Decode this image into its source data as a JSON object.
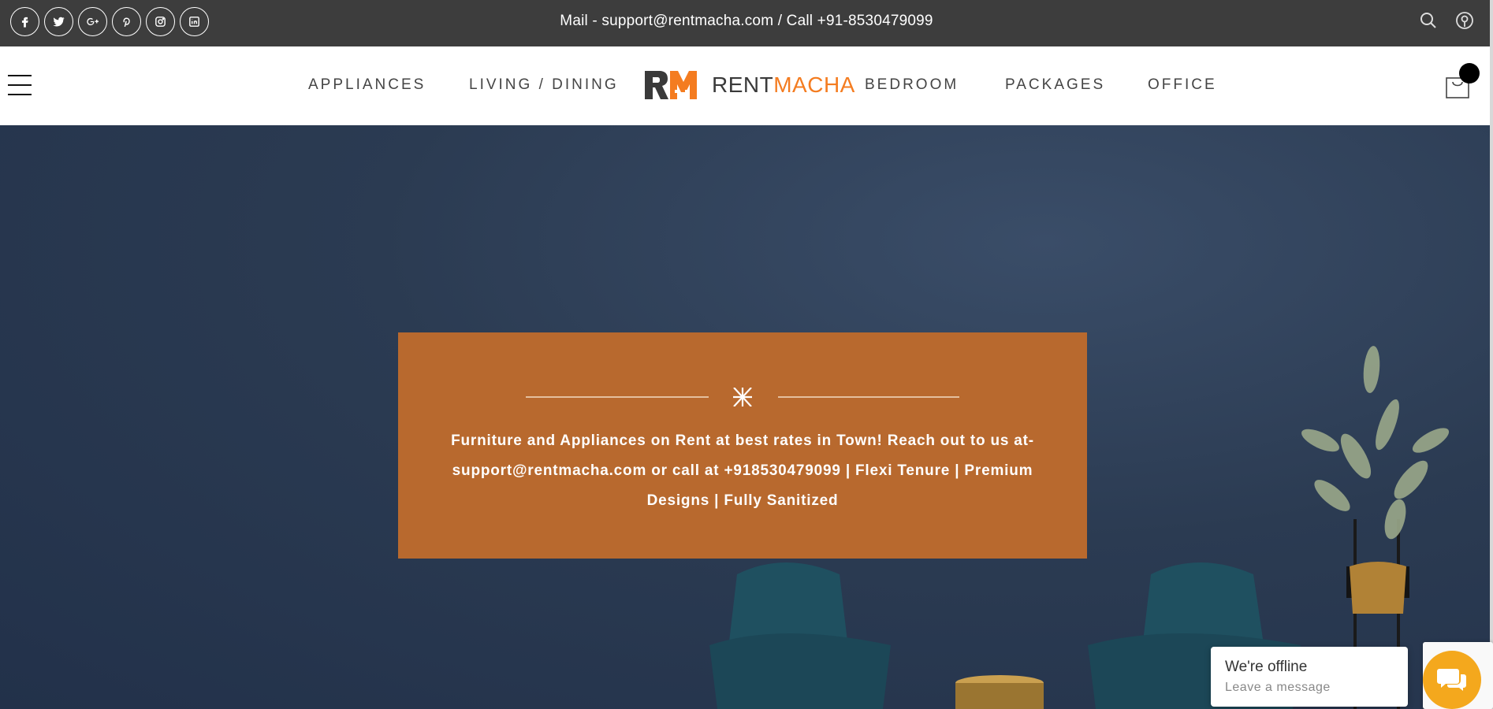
{
  "topbar": {
    "contact": "Mail - support@rentmacha.com / Call +91-8530479099",
    "socials": [
      "facebook-icon",
      "twitter-icon",
      "google-plus-icon",
      "pinterest-icon",
      "instagram-icon",
      "linkedin-icon"
    ],
    "icons": [
      "search-icon",
      "user-icon"
    ]
  },
  "nav": {
    "left": [
      "APPLIANCES",
      "LIVING / DINING"
    ],
    "right": [
      "BEDROOM",
      "PACKAGES",
      "OFFICE"
    ],
    "logo": {
      "rent": "RENT",
      "macha": "MACHA",
      "mark": "RM"
    }
  },
  "banner": {
    "text": "Furniture and Appliances on Rent at best rates in Town! Reach out to us at- support@rentmacha.com or call at +918530479099 | Flexi Tenure | Premium Designs | Fully Sanitized"
  },
  "chat": {
    "title": "We're offline",
    "subtitle": "Leave a message"
  },
  "colors": {
    "topbar": "#3d3d3d",
    "accent": "#f47c20",
    "banner": "#b8692e",
    "hero": "#2b3b52",
    "chat_button": "#f4a81d"
  }
}
